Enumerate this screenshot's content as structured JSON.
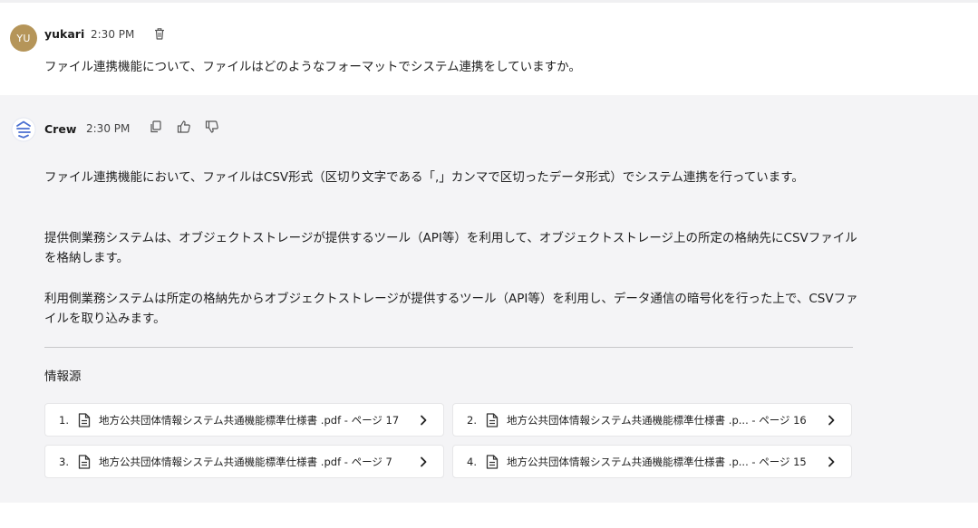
{
  "user_message": {
    "avatar_initials": "YU",
    "author": "yukari",
    "time": "2:30 PM",
    "text": "ファイル連携機能について、ファイルはどのようなフォーマットでシステム連携をしていますか。"
  },
  "bot_message": {
    "author": "Crew",
    "time": "2:30 PM",
    "paragraphs": [
      "ファイル連携機能において、ファイルはCSV形式（区切り文字である「,」カンマで区切ったデータ形式）でシステム連携を行っています。",
      "提供側業務システムは、オブジェクトストレージが提供するツール（API等）を利用して、オブジェクトストレージ上の所定の格納先にCSVファイルを格納します。",
      "利用側業務システムは所定の格納先からオブジェクトストレージが提供するツール（API等）を利用し、データ通信の暗号化を行った上で、CSVファイルを取り込みます。"
    ],
    "sources_title": "情報源",
    "sources": [
      {
        "num": "1.",
        "label": "地方公共団体情報システム共通機能標準仕様書 .pdf - ページ 17"
      },
      {
        "num": "2.",
        "label": "地方公共団体情報システム共通機能標準仕様書 .p...  - ページ 16"
      },
      {
        "num": "3.",
        "label": "地方公共団体情報システム共通機能標準仕様書 .pdf - ページ 7"
      },
      {
        "num": "4.",
        "label": "地方公共団体情報システム共通機能標準仕様書 .p...  - ページ 15"
      }
    ]
  },
  "icons": {
    "delete": "trash-icon",
    "copy": "copy-icon",
    "like": "thumbs-up-icon",
    "dislike": "thumbs-down-icon",
    "document": "document-icon",
    "open": "chevron-right-icon",
    "bot": "crew-logo-icon"
  },
  "colors": {
    "avatar": "#b59559",
    "bot_background": "#f4f4f6",
    "bot_logo": "#4a6fd1"
  }
}
